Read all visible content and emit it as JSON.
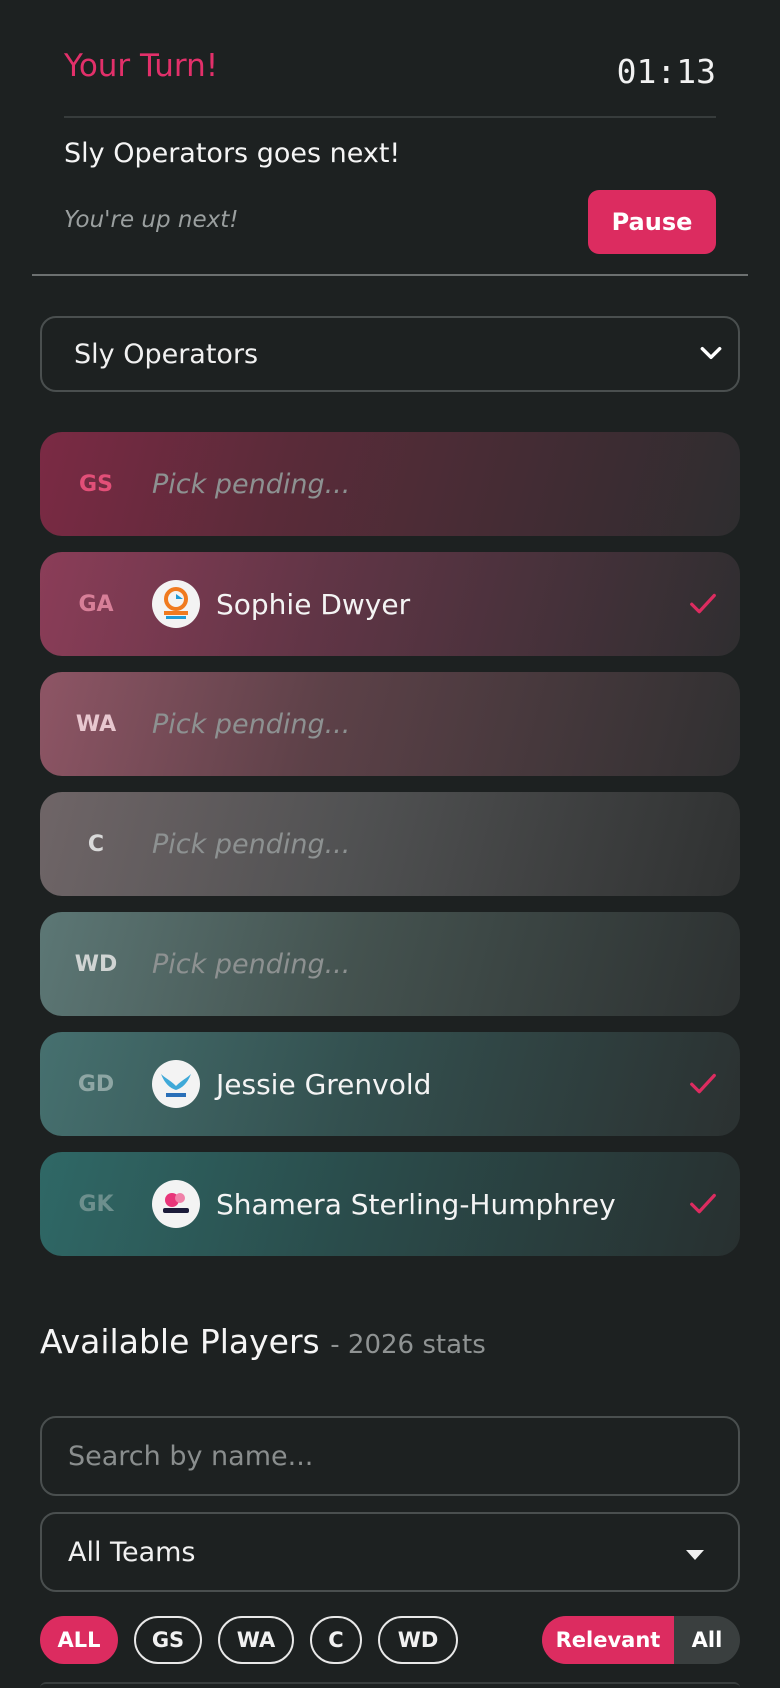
{
  "turn": {
    "title": "Your Turn!",
    "timer": "01:13",
    "next_team_text": "Sly Operators goes next!",
    "up_next_text": "You're up next!",
    "pause_label": "Pause"
  },
  "team_selector": {
    "value": "Sly Operators"
  },
  "slots": [
    {
      "position": "GS",
      "status": "Pick pending...",
      "pos_color": "#e24f78"
    },
    {
      "position": "GA",
      "player": "Sophie Dwyer",
      "team_logo": "giants-netball-logo",
      "pos_color": "#d77f98"
    },
    {
      "position": "WA",
      "status": "Pick pending...",
      "pos_color": "#e8c7cf"
    },
    {
      "position": "C",
      "status": "Pick pending...",
      "pos_color": "#d9d9d9"
    },
    {
      "position": "WD",
      "status": "Pick pending...",
      "pos_color": "#d0d4d3"
    },
    {
      "position": "GD",
      "player": "Jessie Grenvold",
      "team_logo": "mavericks-logo",
      "pos_color": "#8ea6a4"
    },
    {
      "position": "GK",
      "player": "Shamera Sterling-Humphrey",
      "team_logo": "thunderbirds-logo",
      "pos_color": "#6d8f8d"
    }
  ],
  "available": {
    "title": "Available Players",
    "subtitle": "- 2026 stats",
    "search_placeholder": "Search by name...",
    "team_filter": "All Teams",
    "position_chips": [
      "ALL",
      "GS",
      "WA",
      "C",
      "WD"
    ],
    "view_toggle": [
      "Relevant",
      "All"
    ]
  },
  "colors": {
    "accent": "#dc2c60",
    "background": "#1d2121"
  }
}
